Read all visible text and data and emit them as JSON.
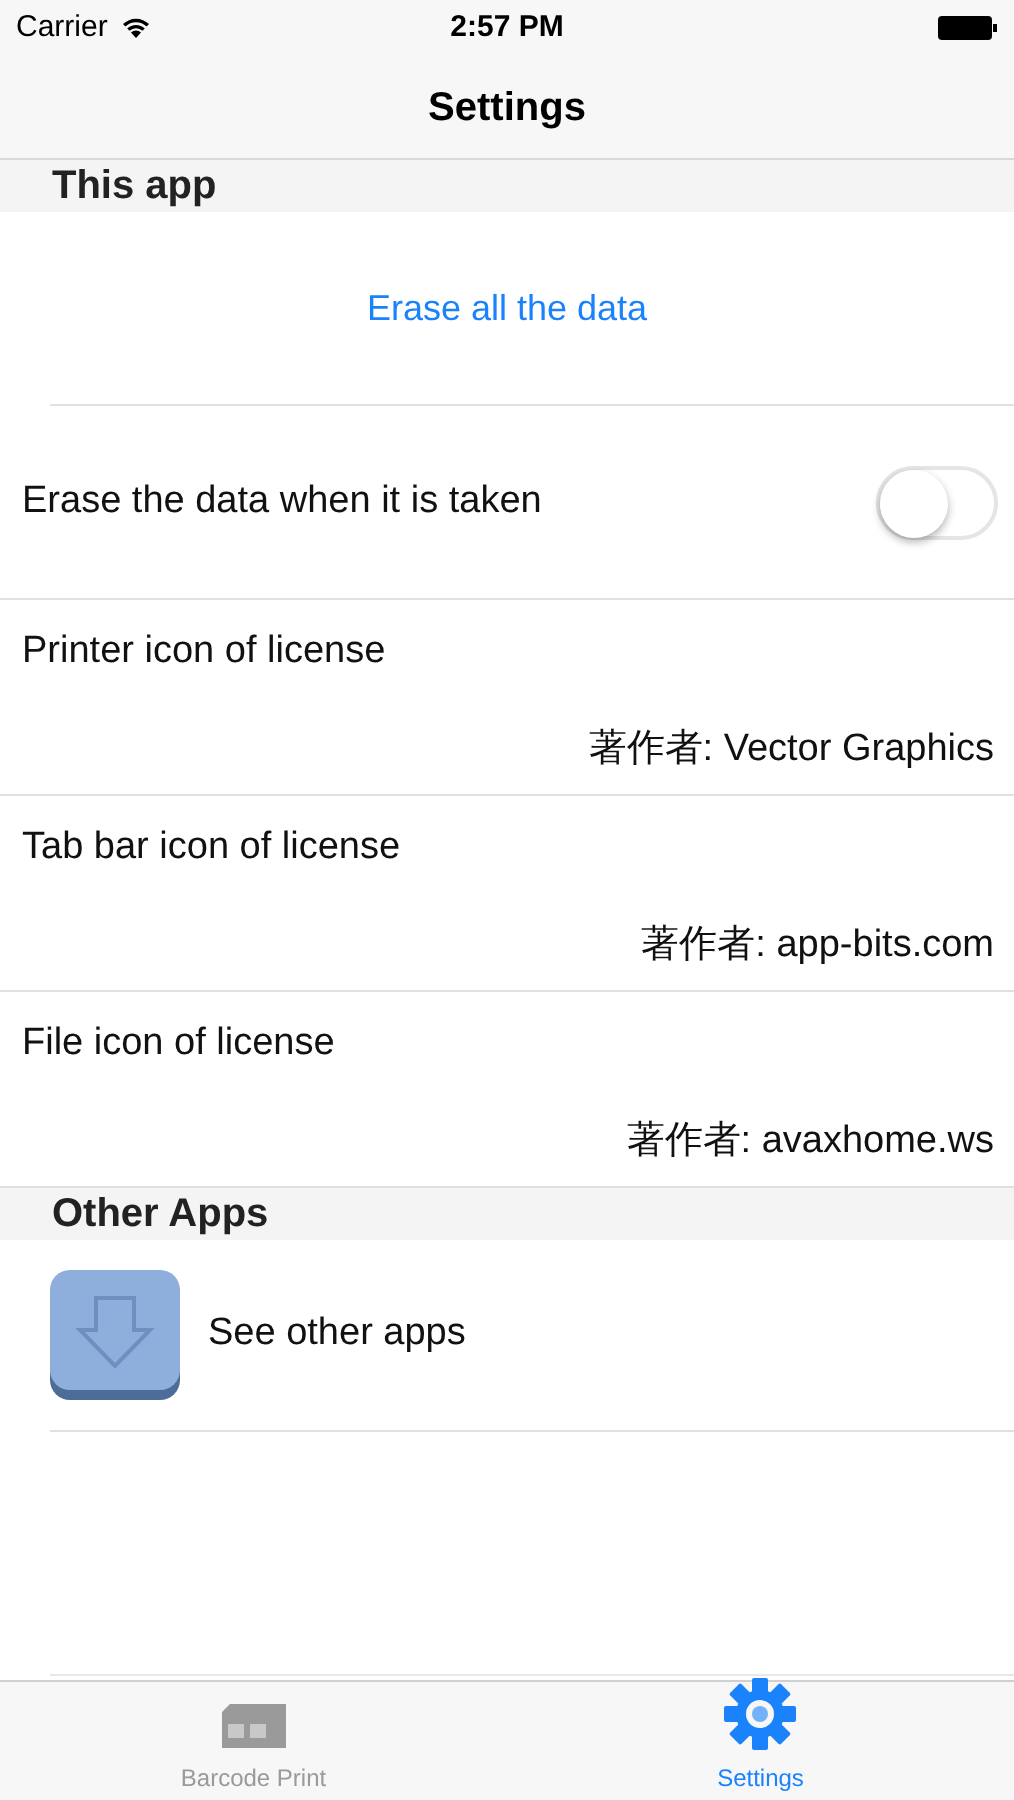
{
  "status_bar": {
    "carrier": "Carrier",
    "time": "2:57 PM"
  },
  "nav": {
    "title": "Settings"
  },
  "sections": [
    {
      "header": "This app",
      "rows": [
        {
          "kind": "action",
          "label": "Erase all the data"
        },
        {
          "kind": "toggle",
          "label": "Erase the data when it is taken",
          "on": false
        },
        {
          "kind": "license",
          "label": "Printer icon of license",
          "detail": "著作者: Vector Graphics"
        },
        {
          "kind": "license",
          "label": "Tab bar icon of license",
          "detail": "著作者: app-bits.com"
        },
        {
          "kind": "license",
          "label": "File icon of license",
          "detail": "著作者: avaxhome.ws"
        }
      ]
    },
    {
      "header": "Other Apps",
      "rows": [
        {
          "kind": "app",
          "label": "See other apps"
        }
      ]
    }
  ],
  "tabs": [
    {
      "label": "Barcode Print",
      "selected": false,
      "kind": "print"
    },
    {
      "label": "Settings",
      "selected": true,
      "kind": "gear"
    }
  ]
}
